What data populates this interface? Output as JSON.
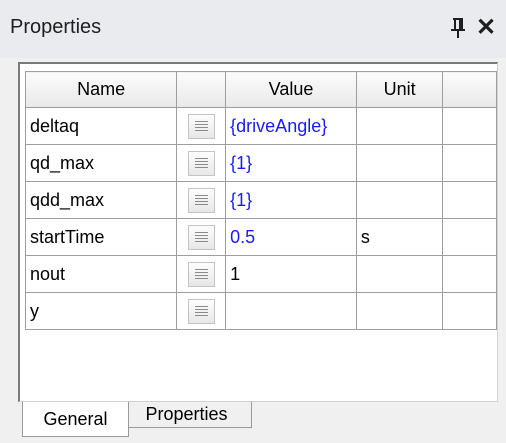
{
  "panel": {
    "title": "Properties",
    "pin_icon": "pin-icon",
    "close_glyph": "✕"
  },
  "grid": {
    "columns": [
      "Name",
      "",
      "Value",
      "Unit",
      ""
    ],
    "rows": [
      {
        "name": "deltaq",
        "value": "{driveAngle}",
        "unit": ""
      },
      {
        "name": "qd_max",
        "value": "{1}",
        "unit": ""
      },
      {
        "name": "qdd_max",
        "value": "{1}",
        "unit": ""
      },
      {
        "name": "startTime",
        "value": "0.5",
        "unit": "s"
      },
      {
        "name": "nout",
        "value": "1",
        "unit": ""
      },
      {
        "name": "y",
        "value": "",
        "unit": ""
      }
    ],
    "button_icon": "list-icon",
    "colors": {
      "param_value": "#1a1aff",
      "literal_value": "#000000"
    }
  },
  "tabs": [
    {
      "label": "General",
      "active": true
    },
    {
      "label": "Properties",
      "active": false
    }
  ]
}
